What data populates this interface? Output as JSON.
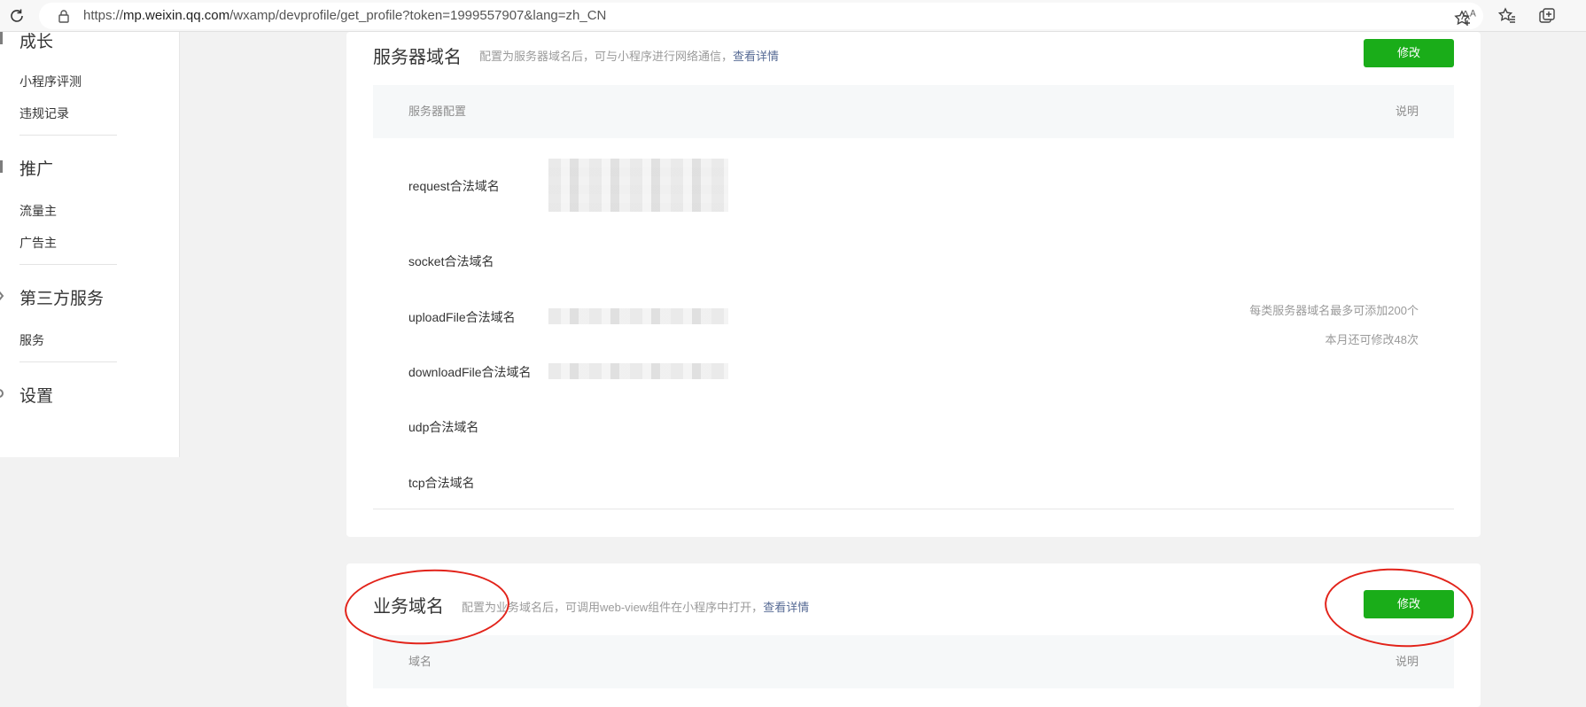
{
  "browser": {
    "url_prefix": "https://",
    "url_host": "mp.weixin.qq.com",
    "url_path": "/wxamp/devprofile/get_profile?token=1999557907&lang=zh_CN",
    "read_aloud_icon": "Aᴬ"
  },
  "sidebar": {
    "groups": [
      {
        "label": "成长",
        "icon": "growth-icon"
      },
      {
        "label": "推广",
        "icon": "promotion-icon"
      },
      {
        "label": "第三方服务",
        "icon": "third-party-icon"
      },
      {
        "label": "设置",
        "icon": "gear-icon"
      }
    ],
    "items": [
      "小程序评测",
      "违规记录",
      "流量主",
      "广告主",
      "服务"
    ]
  },
  "server_domain": {
    "title": "服务器域名",
    "desc": "配置为服务器域名后，可与小程序进行网络通信，",
    "desc_link": "查看详情",
    "button": "修改",
    "col_config": "服务器配置",
    "col_note": "说明",
    "rows": [
      "request合法域名",
      "socket合法域名",
      "uploadFile合法域名",
      "downloadFile合法域名",
      "udp合法域名",
      "tcp合法域名"
    ],
    "note_line1": "每类服务器域名最多可添加200个",
    "note_line2": "本月还可修改48次"
  },
  "business_domain": {
    "title": "业务域名",
    "desc": "配置为业务域名后，可调用web-view组件在小程序中打开，",
    "desc_link": "查看详情",
    "button": "修改",
    "col_domain": "域名",
    "col_note": "说明"
  },
  "colors": {
    "accent_green": "#1aad19",
    "link_blue": "#576b95",
    "annotation_red": "#e2231a"
  }
}
